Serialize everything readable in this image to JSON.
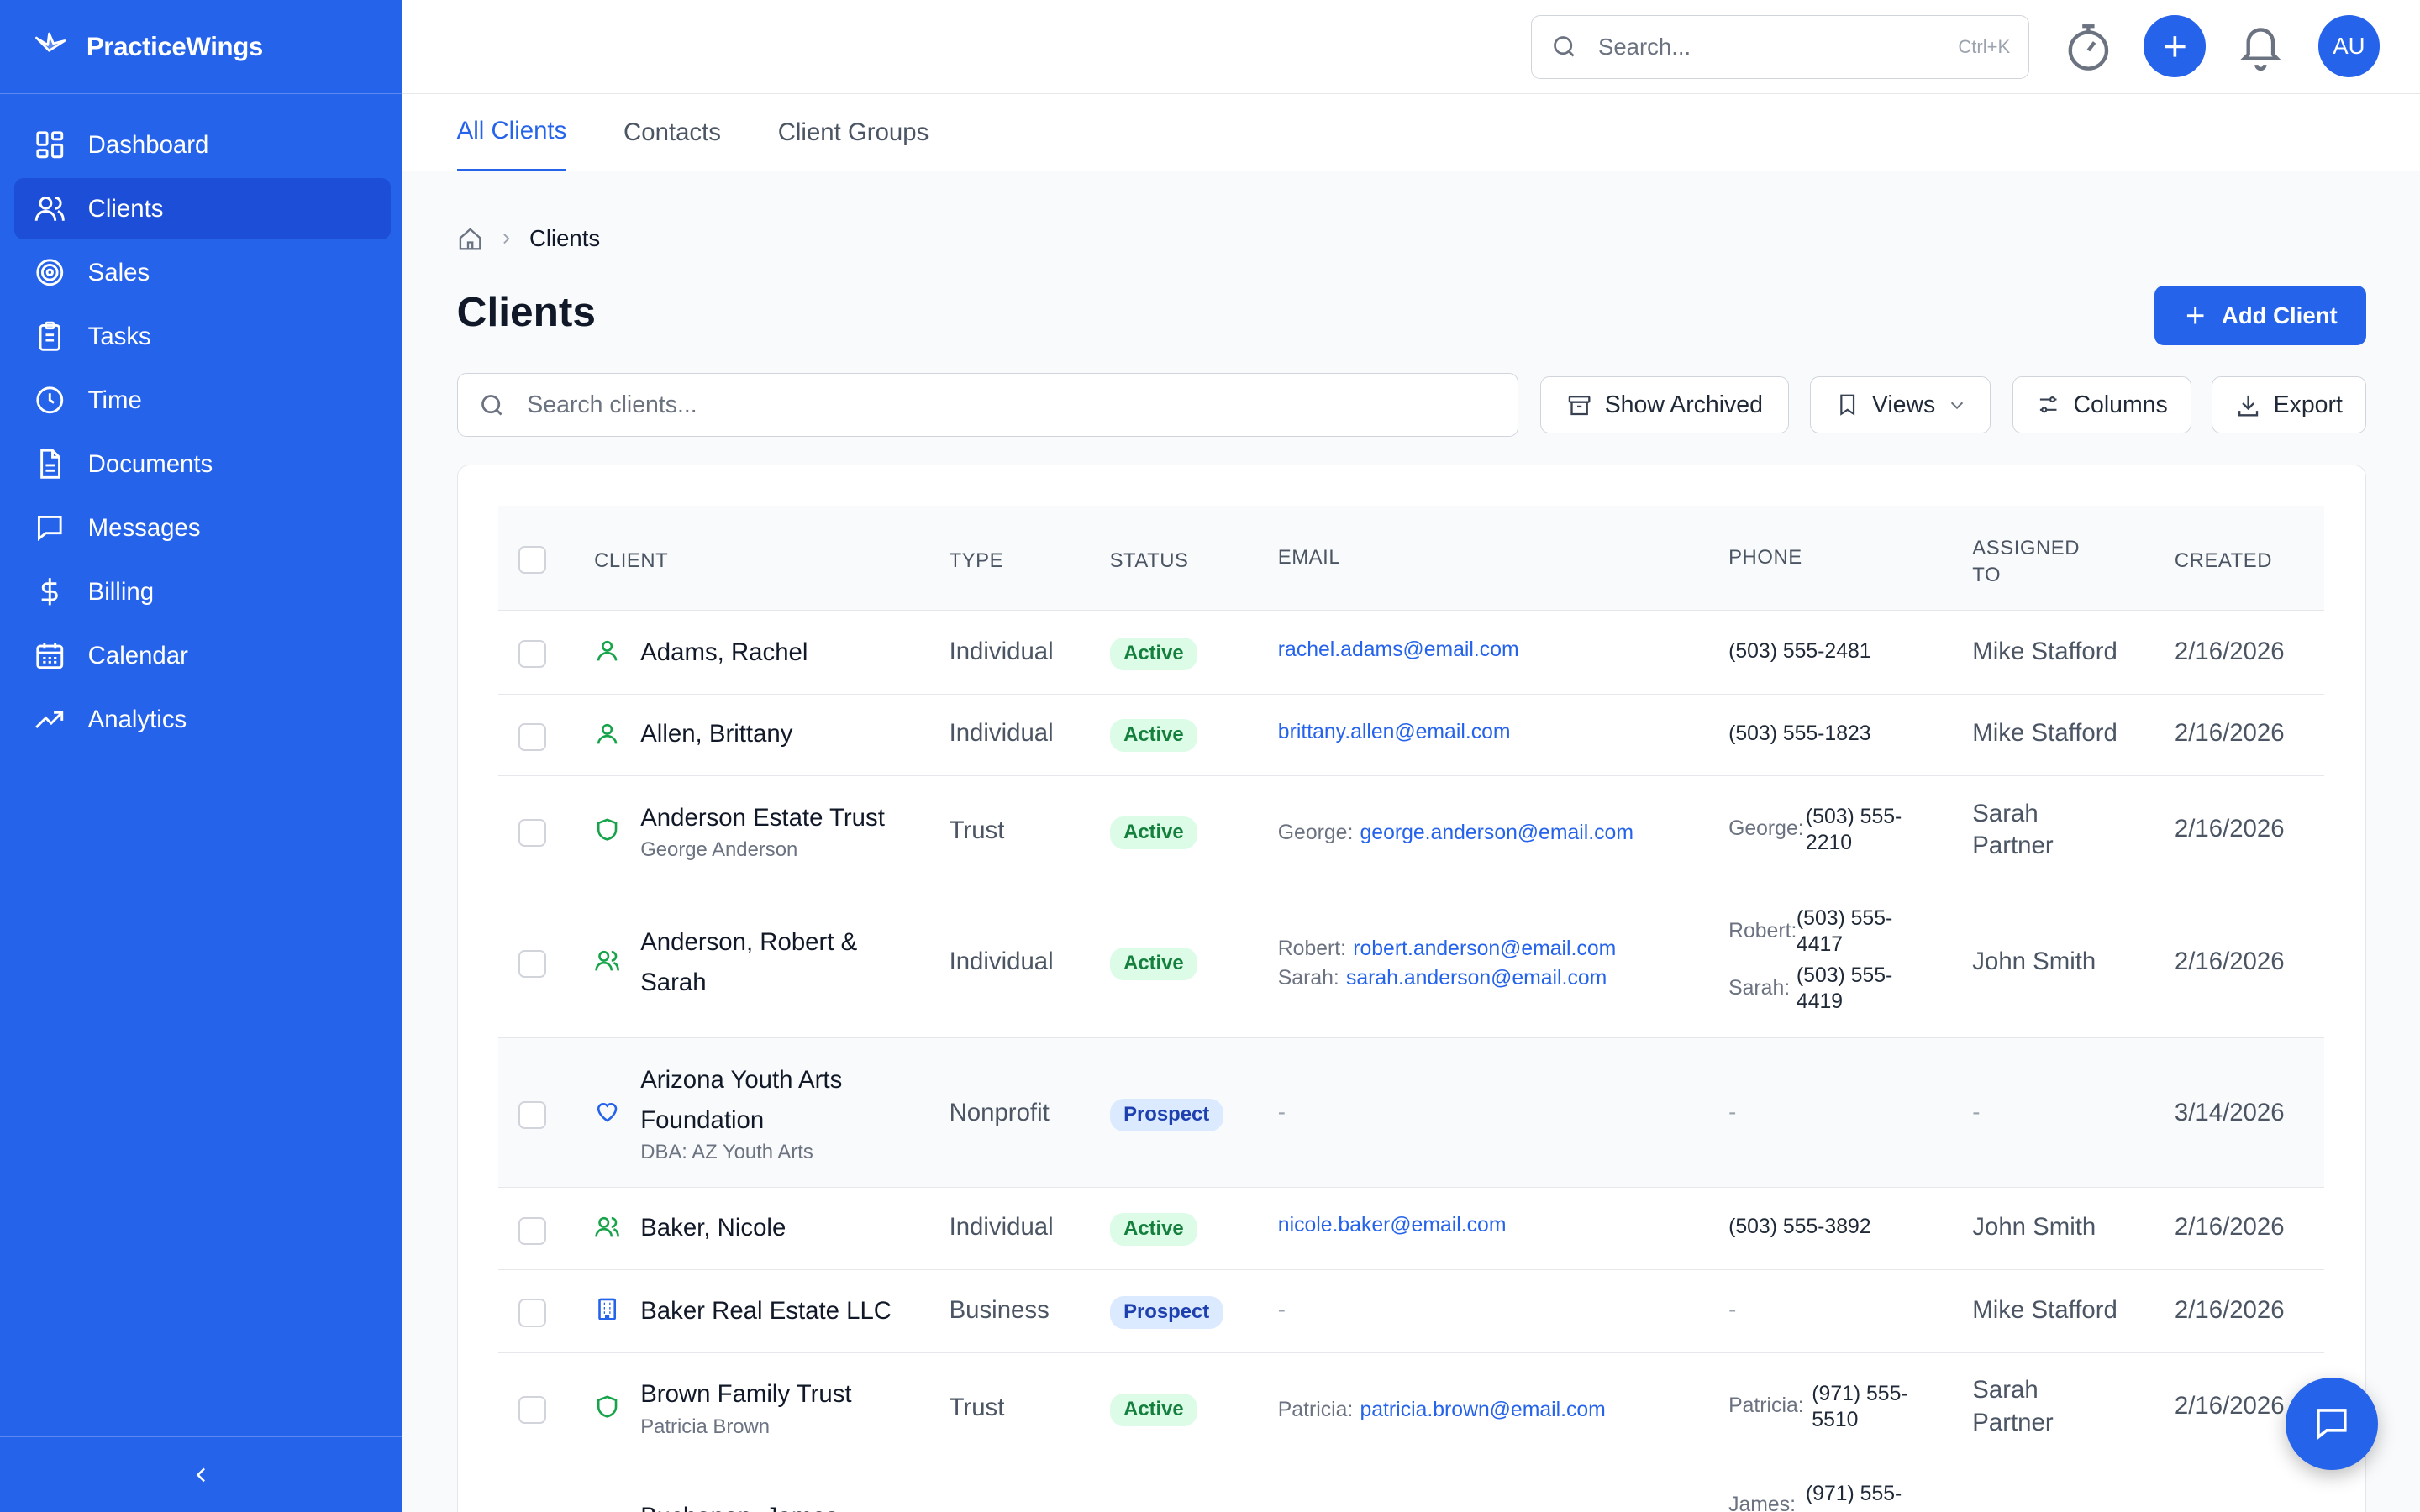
{
  "app": {
    "name": "PracticeWings"
  },
  "search": {
    "placeholder": "Search...",
    "shortcut": "Ctrl+K"
  },
  "user": {
    "initials": "AU"
  },
  "sidebar": {
    "items": [
      {
        "label": "Dashboard",
        "icon": "dashboard-icon"
      },
      {
        "label": "Clients",
        "icon": "users-icon",
        "active": true
      },
      {
        "label": "Sales",
        "icon": "target-icon"
      },
      {
        "label": "Tasks",
        "icon": "clipboard-icon"
      },
      {
        "label": "Time",
        "icon": "clock-icon"
      },
      {
        "label": "Documents",
        "icon": "file-icon"
      },
      {
        "label": "Messages",
        "icon": "message-icon"
      },
      {
        "label": "Billing",
        "icon": "dollar-icon"
      },
      {
        "label": "Calendar",
        "icon": "calendar-icon"
      },
      {
        "label": "Analytics",
        "icon": "trending-icon"
      }
    ]
  },
  "tabs": [
    {
      "label": "All Clients",
      "active": true
    },
    {
      "label": "Contacts"
    },
    {
      "label": "Client Groups"
    }
  ],
  "breadcrumb": {
    "current": "Clients"
  },
  "page": {
    "title": "Clients",
    "add_button": "Add Client"
  },
  "toolbar": {
    "search_placeholder": "Search clients...",
    "show_archived": "Show Archived",
    "views": "Views",
    "columns": "Columns",
    "export": "Export"
  },
  "table": {
    "headers": {
      "client": "CLIENT",
      "type": "TYPE",
      "status": "STATUS",
      "email": "EMAIL",
      "phone": "PHONE",
      "assigned_line1": "ASSIGNED",
      "assigned_line2": "TO",
      "created": "CREATED"
    },
    "rows": [
      {
        "name": "Adams, Rachel",
        "type": "Individual",
        "status": "Active",
        "email": "rachel.adams@email.com",
        "phone": "(503) 555-2481",
        "assigned": "Mike Stafford",
        "created": "2/16/2026"
      },
      {
        "name": "Allen, Brittany",
        "type": "Individual",
        "status": "Active",
        "email": "brittany.allen@email.com",
        "phone": "(503) 555-1823",
        "assigned": "Mike Stafford",
        "created": "2/16/2026"
      },
      {
        "name": "Anderson Estate Trust",
        "sub": "George Anderson",
        "type": "Trust",
        "status": "Active",
        "email_label": "George:",
        "email": "george.anderson@email.com",
        "phone_label": "George:",
        "phone_line1": "(503) 555-",
        "phone_line2": "2210",
        "assigned_line1": "Sarah",
        "assigned_line2": "Partner",
        "created": "2/16/2026"
      },
      {
        "name_line1": "Anderson, Robert &",
        "name_line2": "Sarah",
        "type": "Individual",
        "status": "Active",
        "email_label1": "Robert:",
        "email1": "robert.anderson@email.com",
        "email_label2": "Sarah:",
        "email2": "sarah.anderson@email.com",
        "phone_label1": "Robert:",
        "phone1_line1": "(503) 555-",
        "phone1_line2": "4417",
        "phone_label2": "Sarah:",
        "phone2_line1": "(503) 555-",
        "phone2_line2": "4419",
        "assigned": "John Smith",
        "created": "2/16/2026"
      },
      {
        "name_line1": "Arizona Youth Arts",
        "name_line2": "Foundation",
        "sub": "DBA: AZ Youth Arts",
        "type": "Nonprofit",
        "status": "Prospect",
        "email": "-",
        "phone": "-",
        "assigned": "-",
        "created": "3/14/2026"
      },
      {
        "name": "Baker, Nicole",
        "type": "Individual",
        "status": "Active",
        "email": "nicole.baker@email.com",
        "phone": "(503) 555-3892",
        "assigned": "John Smith",
        "created": "2/16/2026"
      },
      {
        "name": "Baker Real Estate LLC",
        "type": "Business",
        "status": "Prospect",
        "email": "-",
        "phone": "-",
        "assigned": "Mike Stafford",
        "created": "2/16/2026"
      },
      {
        "name": "Brown Family Trust",
        "sub": "Patricia Brown",
        "type": "Trust",
        "status": "Active",
        "email_label": "Patricia:",
        "email": "patricia.brown@email.com",
        "phone_label": "Patricia:",
        "phone_line1": "(971) 555-",
        "phone_line2": "5510",
        "assigned_line1": "Sarah",
        "assigned_line2": "Partner",
        "created": "2/16/2026"
      },
      {
        "name": "Buchanan, James",
        "phone_label": "James:",
        "phone_line1": "(971) 555-"
      }
    ]
  },
  "colors": {
    "accent": "#2563eb",
    "active_badge": "#dcfce7",
    "prospect_badge": "#dbeafe"
  }
}
